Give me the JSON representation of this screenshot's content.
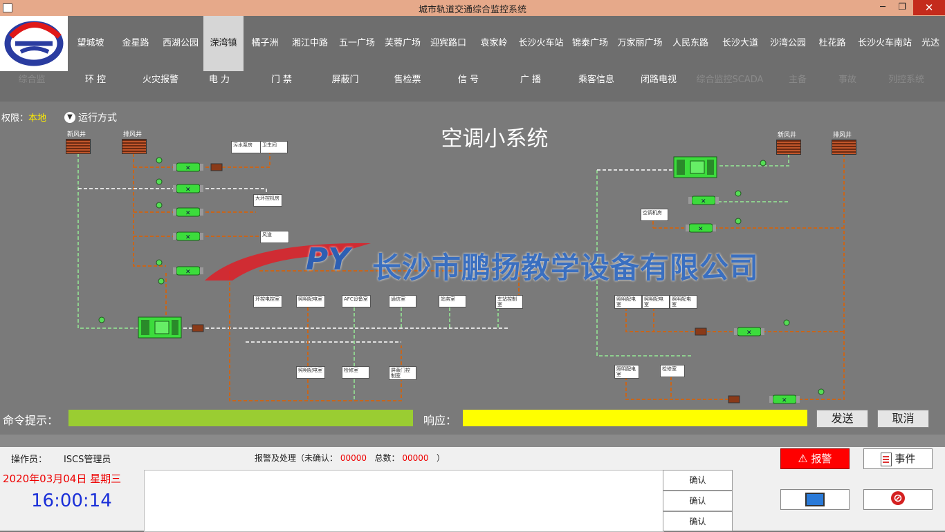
{
  "window": {
    "title": "城市轨道交通综合监控系统",
    "min_glyph": "─",
    "max_glyph": "❐",
    "close_glyph": "✕"
  },
  "stations": [
    "望城坡",
    "金星路",
    "西湖公园",
    "溁湾镇",
    "橘子洲",
    "湘江中路",
    "五一广场",
    "芙蓉广场",
    "迎宾路口",
    "袁家岭",
    "长沙火车站",
    "锦泰广场",
    "万家丽广场",
    "人民东路",
    "长沙大道",
    "沙湾公园",
    "杜花路",
    "长沙火车南站",
    "光达"
  ],
  "active_station": "溁湾镇",
  "subsystems": [
    "环 控",
    "火灾报警",
    "电 力",
    "门 禁",
    "屏蔽门",
    "售检票",
    "信 号",
    "广 播",
    "乘客信息",
    "闭路电视"
  ],
  "hidden_subsystems": [
    "综合监",
    "综合监控SCADA",
    "主备",
    "事故",
    "列控系统"
  ],
  "permission": {
    "label": "权限：",
    "value": "本地"
  },
  "run_mode": {
    "label": "运行方式",
    "icon": "chevron-down-icon"
  },
  "system_title": "空调小系统",
  "watermark": {
    "logo_text": "PY",
    "company": "长沙市鹏扬教学设备有限公司"
  },
  "diagram": {
    "vents": [
      {
        "label": "新风井"
      },
      {
        "label": "排风井"
      },
      {
        "label": "新风井"
      },
      {
        "label": "排风井"
      }
    ],
    "rooms_left": [
      "污水泵房",
      "卫生间",
      "大环控机房",
      "风道",
      "环控电控室",
      "照明配电室",
      "AFC设备室",
      "通信室",
      "站务室",
      "车站控制室",
      "照明配电室",
      "检修室",
      "屏蔽门控制室"
    ],
    "rooms_right": [
      "空调机房",
      "照明配电室",
      "照明配电室",
      "照明配电室",
      "照明配电室",
      "检修室"
    ]
  },
  "command": {
    "label": "命令提示：",
    "value": ""
  },
  "response": {
    "label": "响应：",
    "value": ""
  },
  "buttons": {
    "send": "发送",
    "cancel": "取消"
  },
  "footer": {
    "operator_label": "操作员：",
    "operator_value": "ISCS管理员",
    "alarm_header": {
      "prefix": "报警及处理（未确认：",
      "unconfirmed": "00000",
      "total_label": "总数：",
      "total": "00000",
      "suffix": "）"
    },
    "date": "2020年03月04日  星期三",
    "time": "16:00:14",
    "ack_label": "确认",
    "alarm_button": "报警",
    "event_button": "事件"
  },
  "colors": {
    "accent_red": "#ff0000",
    "cmd_green": "#9acd32",
    "resp_yellow": "#ffff00",
    "clock_blue": "#1a2fd8"
  }
}
